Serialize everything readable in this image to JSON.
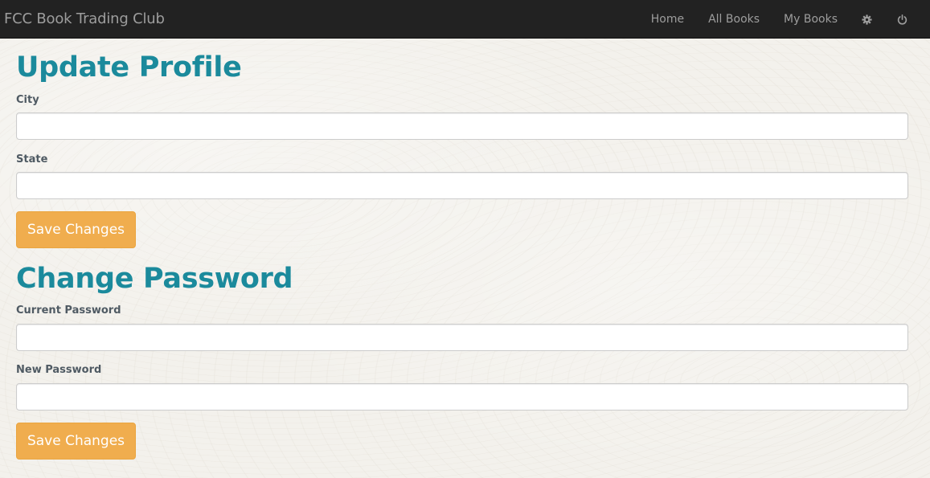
{
  "navbar": {
    "brand": "FCC Book Trading Club",
    "links": [
      "Home",
      "All Books",
      "My Books"
    ],
    "settings_icon": "gear-icon",
    "logout_icon": "power-icon",
    "background_color": "#222222",
    "text_color": "#9d9d9d"
  },
  "update_profile": {
    "title": "Update Profile",
    "city_label": "City",
    "city_value": "",
    "state_label": "State",
    "state_value": "",
    "save_label": "Save Changes"
  },
  "change_password": {
    "title": "Change Password",
    "current_label": "Current Password",
    "current_value": "",
    "new_label": "New Password",
    "new_value": "",
    "save_label": "Save Changes"
  },
  "colors": {
    "heading": "#1b8a9c",
    "button": "#f0ad4e",
    "page_background": "#f3f1ec"
  }
}
